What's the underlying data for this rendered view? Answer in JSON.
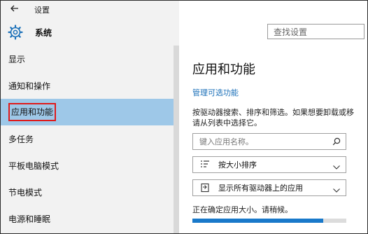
{
  "window": {
    "title": "设置",
    "back_icon": "back-arrow-icon"
  },
  "header": {
    "label": "系统",
    "icon": "gear-icon"
  },
  "search": {
    "placeholder": "查找设置"
  },
  "sidebar": {
    "items": [
      {
        "label": "显示",
        "active": false
      },
      {
        "label": "通知和操作",
        "active": false
      },
      {
        "label": "应用和功能",
        "active": true
      },
      {
        "label": "多任务",
        "active": false
      },
      {
        "label": "平板电脑模式",
        "active": false
      },
      {
        "label": "节电模式",
        "active": false
      },
      {
        "label": "电源和睡眠",
        "active": false
      }
    ]
  },
  "main": {
    "title": "应用和功能",
    "manage_link": "管理可选功能",
    "description_line1": "按驱动器搜索、排序和筛选。如果想要卸载或移",
    "description_line2": "请从列表中选择它。",
    "search_apps": {
      "placeholder": "键入应用名称。",
      "icon": "search-icon"
    },
    "sort_dropdown": {
      "value": "按大小排序",
      "icon": "sort-icon"
    },
    "drive_dropdown": {
      "value": "显示所有驱动器上的应用",
      "icon": "drive-icon"
    },
    "status_text": "正在确定应用大小。请稍候。",
    "progress_fraction": 0.85
  },
  "colors": {
    "active_highlight": "#9ec8e8",
    "link": "#1a6fb8",
    "progress": "#1979ca",
    "annotation": "#e01a1a"
  }
}
